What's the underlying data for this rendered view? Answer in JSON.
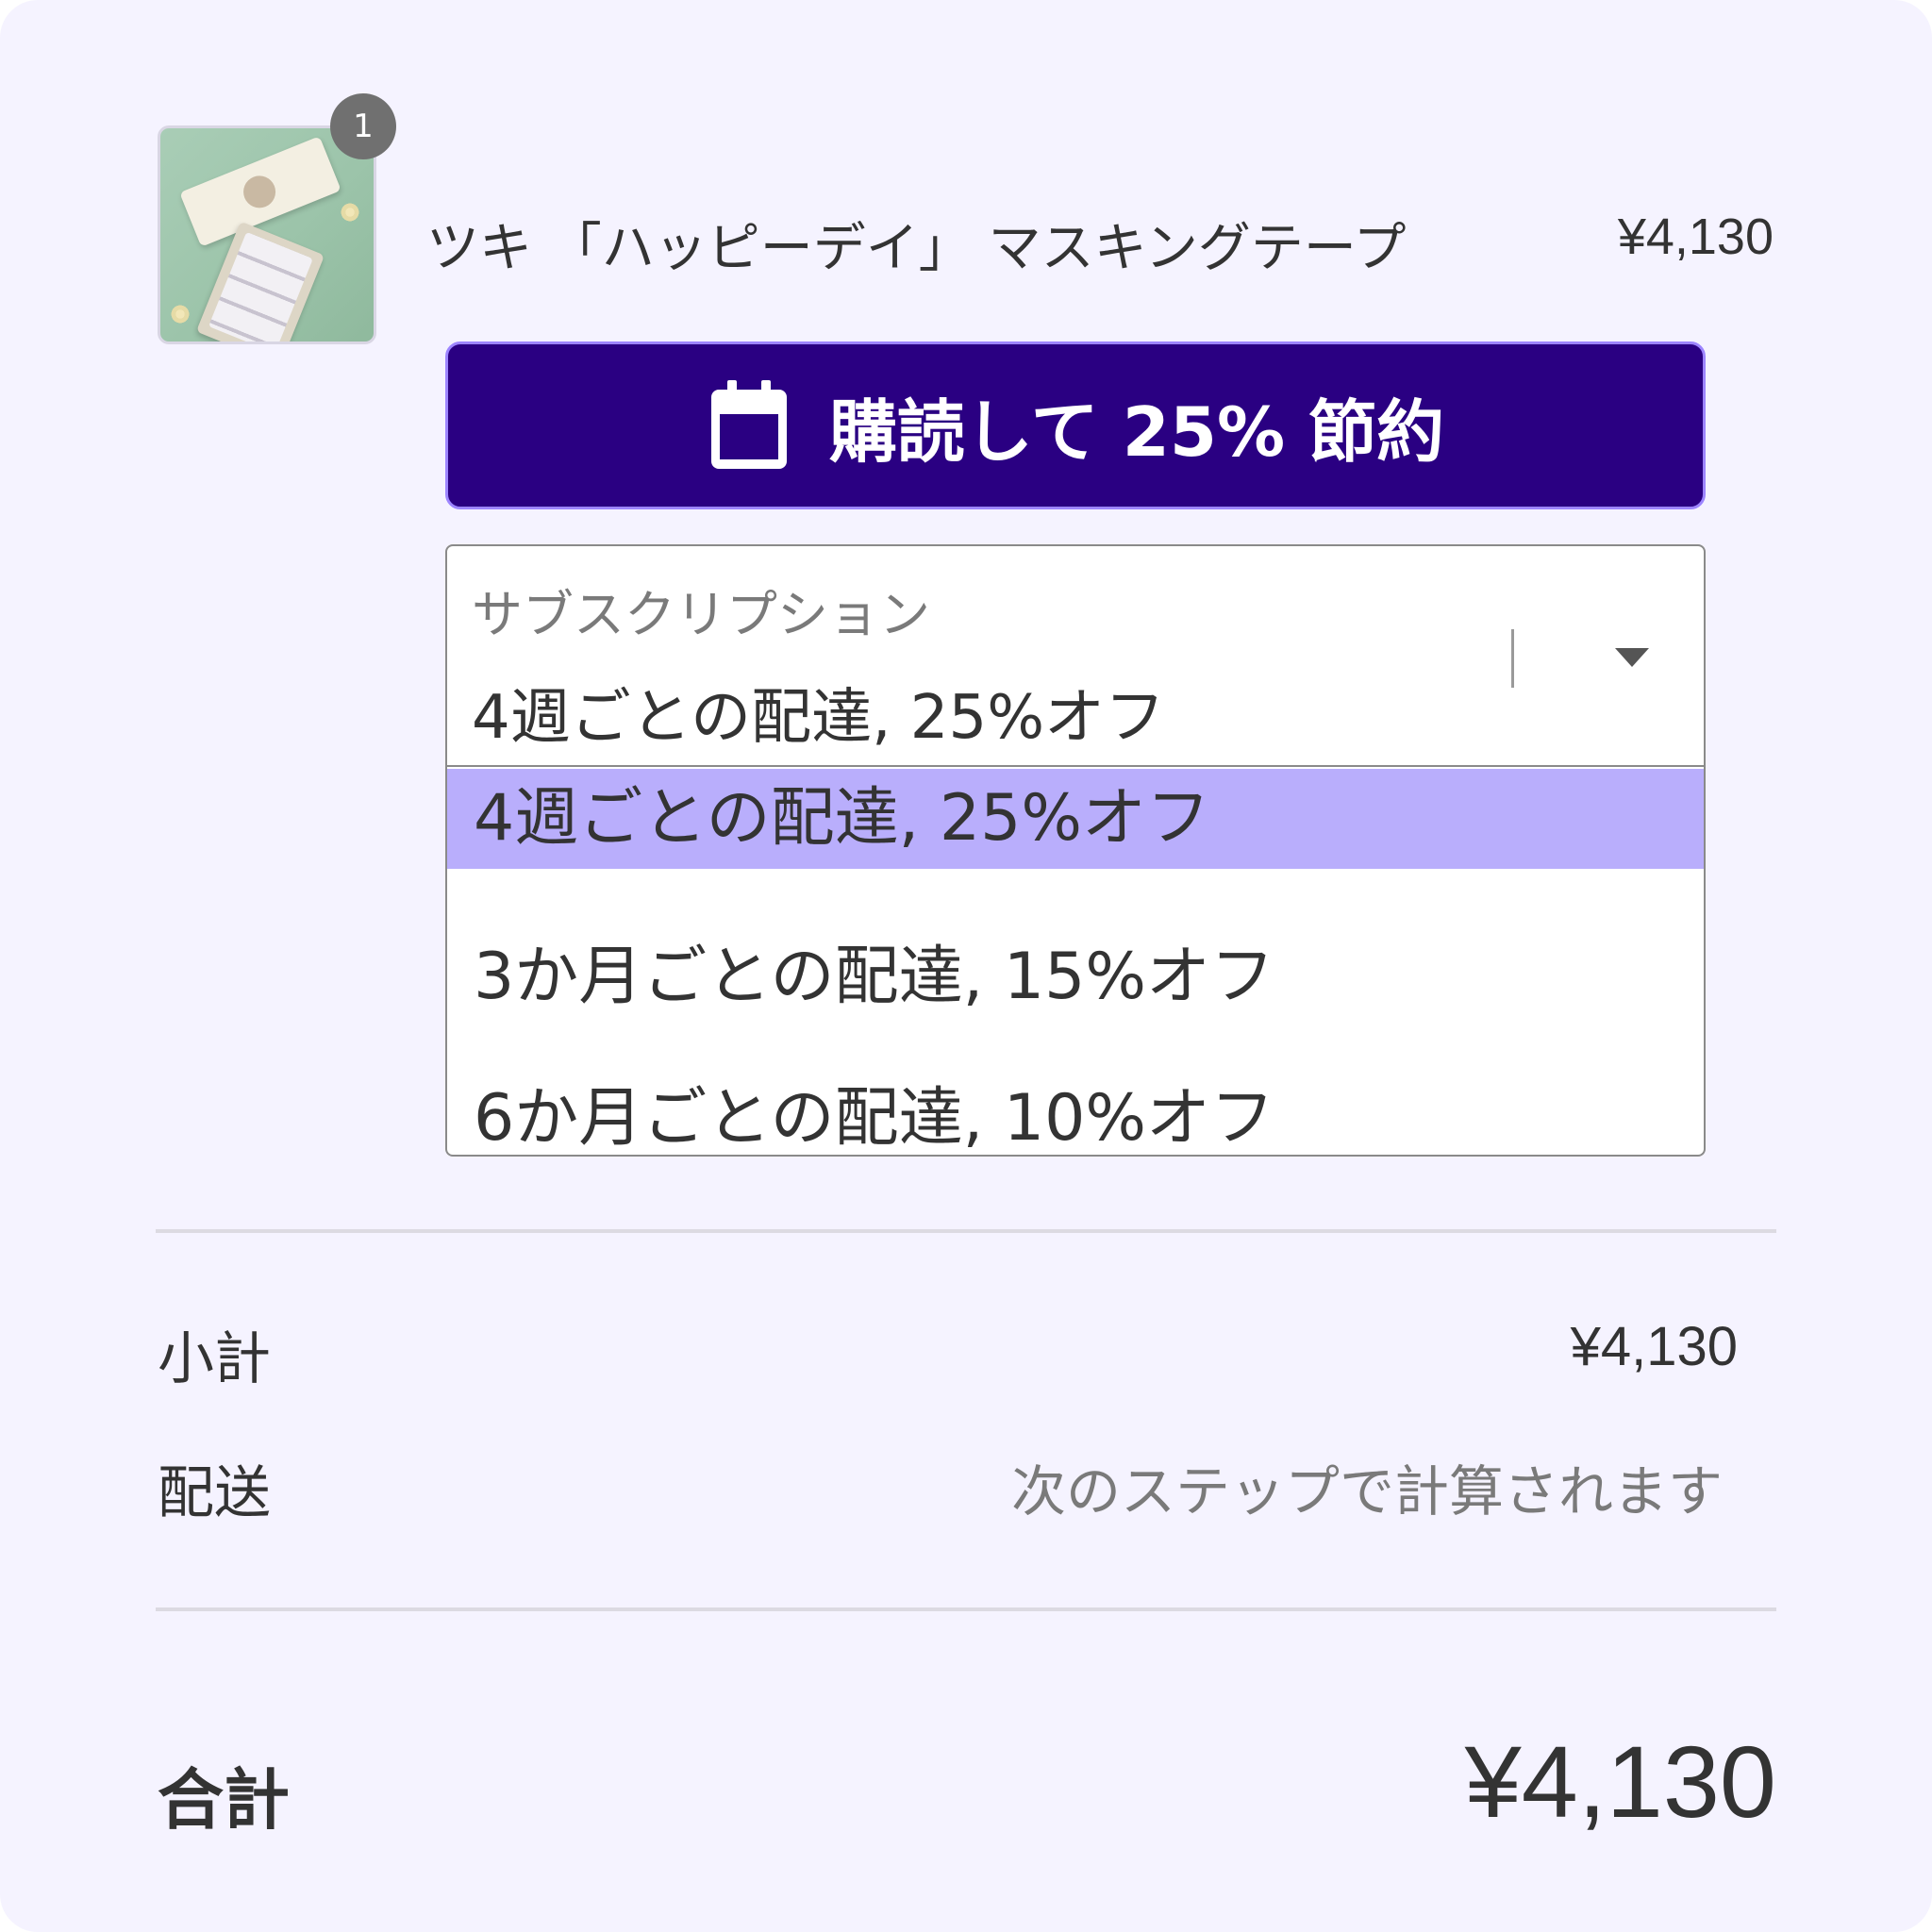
{
  "product": {
    "quantity_badge": "1",
    "name": "ツキ 「ハッピーデイ」 マスキングテープ",
    "price": "¥4,130",
    "image_icon": "product-image"
  },
  "subscribe_button": {
    "label": "購読して 25% 節約",
    "icon": "calendar-icon",
    "background_color": "#2a0082"
  },
  "subscription_select": {
    "label": "サブスクリプション",
    "selected_value": "4週ごとの配達, 25%オフ",
    "options": [
      "4週ごとの配達, 25%オフ",
      "3か月ごとの配達, 15%オフ",
      "6か月ごとの配達, 10%オフ"
    ],
    "highlight_color": "#b9aefc"
  },
  "summary": {
    "subtotal_label": "小計",
    "subtotal_value": "¥4,130",
    "shipping_label": "配送",
    "shipping_value": "次のステップで計算されます",
    "total_label": "合計",
    "total_value": "¥4,130"
  },
  "colors": {
    "page_background": "#f5f3ff",
    "text": "#333333",
    "muted_text": "#7a7a7a"
  }
}
